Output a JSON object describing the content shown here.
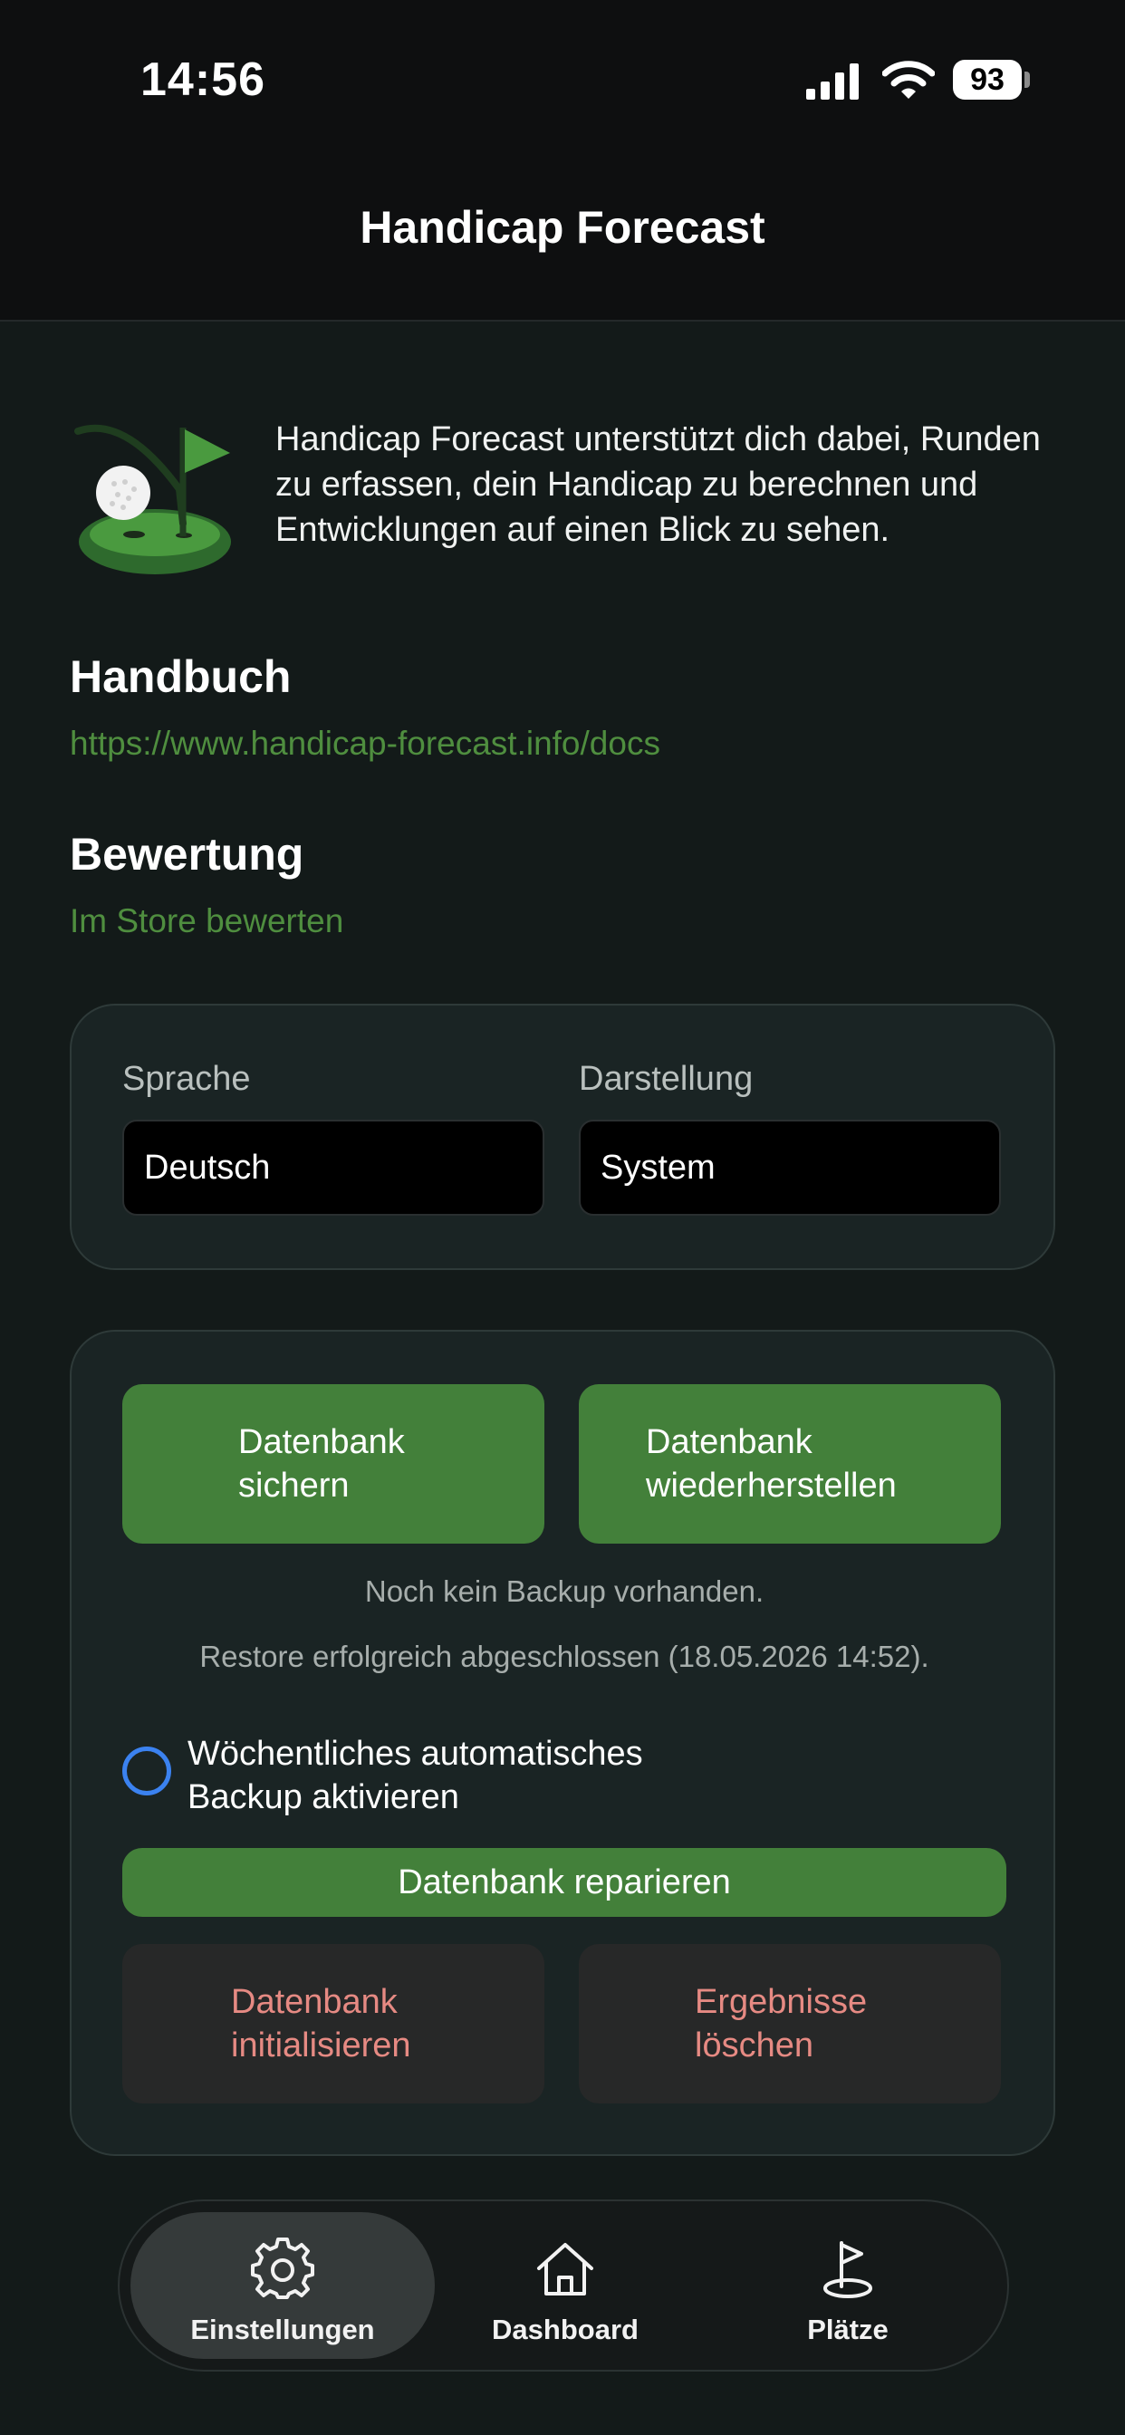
{
  "status_bar": {
    "time": "14:56",
    "battery": "93"
  },
  "header": {
    "title": "Handicap Forecast"
  },
  "intro": {
    "text": "Handicap Forecast unterstützt dich dabei, Runden zu erfassen, dein Handicap zu berechnen und Entwicklungen auf einen Blick zu sehen."
  },
  "manual": {
    "title": "Handbuch",
    "link": "https://www.handicap-forecast.info/docs"
  },
  "rating": {
    "title": "Bewertung",
    "link": "Im Store bewerten"
  },
  "settings": {
    "language_label": "Sprache",
    "language_value": "Deutsch",
    "appearance_label": "Darstellung",
    "appearance_value": "System"
  },
  "backup": {
    "save_line1": "Datenbank",
    "save_line2": "sichern",
    "restore_line1": "Datenbank",
    "restore_line2": "wiederherstellen",
    "no_backup": "Noch kein Backup vorhanden.",
    "restore_status": "Restore erfolgreich abgeschlossen (18.05.2026 14:52).",
    "weekly_line1": "Wöchentliches automatisches",
    "weekly_line2": "Backup aktivieren",
    "weekly_enabled": false,
    "repair": "Datenbank reparieren",
    "init_line1": "Datenbank",
    "init_line2": "initialisieren",
    "delete_line1": "Ergebnisse",
    "delete_line2": "löschen"
  },
  "nav": {
    "items": [
      {
        "label": "Einstellungen",
        "icon": "gear-icon",
        "active": true
      },
      {
        "label": "Dashboard",
        "icon": "home-icon",
        "active": false
      },
      {
        "label": "Plätze",
        "icon": "golf-flag-icon",
        "active": false
      }
    ]
  },
  "colors": {
    "accent_green": "#43803a",
    "link_green": "#4f8e3f",
    "danger_text": "#e68a83",
    "radio_blue": "#3b82f0"
  }
}
